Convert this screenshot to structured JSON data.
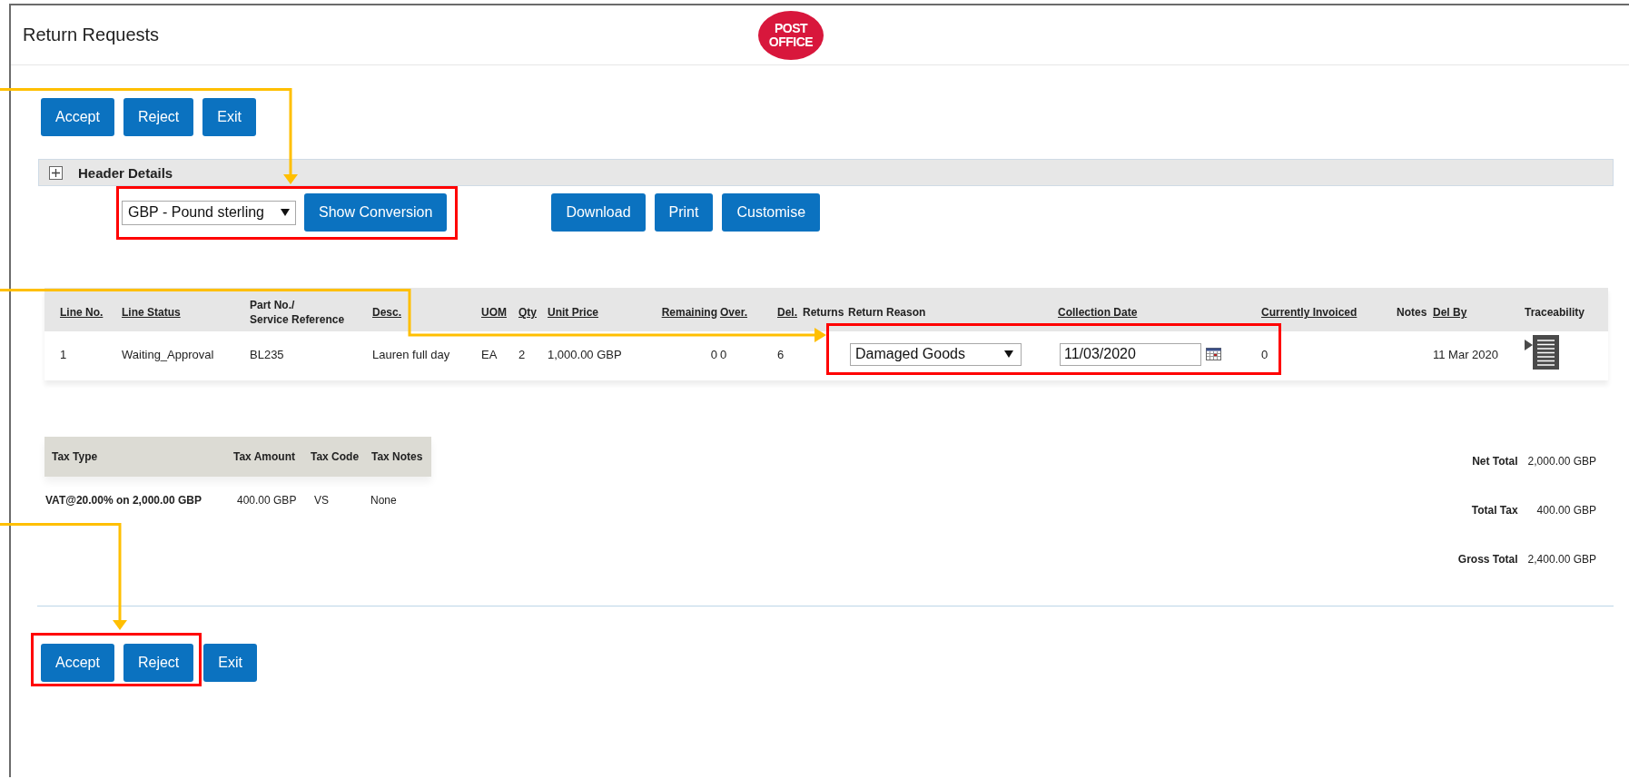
{
  "window": {
    "title": "Return Requests"
  },
  "logo": {
    "lines": [
      "POST",
      "OFFICE"
    ]
  },
  "top_actions": [
    "Accept",
    "Reject",
    "Exit"
  ],
  "header_details": {
    "label": "Header Details",
    "expanded": false
  },
  "currency": {
    "value": "GBP - Pound sterling"
  },
  "conversion_button": "Show Conversion",
  "document_actions": [
    "Download",
    "Print",
    "Customise"
  ],
  "lines_table": {
    "columns": [
      {
        "label": "Line No.",
        "sortable": true
      },
      {
        "label": "Line Status",
        "sortable": true
      },
      {
        "label": "Part No./\nService Reference",
        "sortable": false
      },
      {
        "label": "Desc.",
        "sortable": true
      },
      {
        "label": "UOM",
        "sortable": true
      },
      {
        "label": "Qty",
        "sortable": true
      },
      {
        "label": "Unit Price",
        "sortable": true
      },
      {
        "label": "Remaining",
        "sortable": true
      },
      {
        "label": "Over.",
        "sortable": true
      },
      {
        "label": "Del.",
        "sortable": true
      },
      {
        "label": "Returns",
        "sortable": false
      },
      {
        "label": "Return Reason",
        "sortable": false
      },
      {
        "label": "Collection Date",
        "sortable": true
      },
      {
        "label": "Currently Invoiced",
        "sortable": true
      },
      {
        "label": "Notes",
        "sortable": false
      },
      {
        "label": "Del By",
        "sortable": true
      },
      {
        "label": "Traceability",
        "sortable": false
      }
    ],
    "rows": [
      {
        "cells": [
          {
            "kind": "text",
            "value": "1"
          },
          {
            "kind": "text",
            "value": "Waiting_Approval"
          },
          {
            "kind": "text",
            "value": "BL235"
          },
          {
            "kind": "text",
            "value": "Lauren full day"
          },
          {
            "kind": "text",
            "value": "EA"
          },
          {
            "kind": "text",
            "value": "2"
          },
          {
            "kind": "text",
            "value": "1,000.00 GBP"
          },
          {
            "kind": "text",
            "value": "0"
          },
          {
            "kind": "text",
            "value": "0"
          },
          {
            "kind": "text",
            "value": "6"
          },
          {
            "kind": "blank"
          },
          {
            "kind": "select",
            "value": "Damaged Goods"
          },
          {
            "kind": "date",
            "value": "11/03/2020"
          },
          {
            "kind": "text",
            "value": "0"
          },
          {
            "kind": "blank"
          },
          {
            "kind": "text",
            "value": "11 Mar 2020"
          },
          {
            "kind": "icon"
          }
        ]
      }
    ]
  },
  "tax_table": {
    "columns": [
      "Tax Type",
      "Tax Amount",
      "Tax Code",
      "Tax Notes"
    ],
    "rows": [
      [
        "VAT@20.00% on 2,000.00 GBP",
        "400.00 GBP",
        "VS",
        "None"
      ]
    ]
  },
  "totals": [
    {
      "label": "Net Total",
      "value": "2,000.00 GBP"
    },
    {
      "label": "Total Tax",
      "value": "400.00 GBP"
    },
    {
      "label": "Gross Total",
      "value": "2,400.00 GBP"
    }
  ],
  "bottom_actions": [
    "Accept",
    "Reject",
    "Exit"
  ]
}
